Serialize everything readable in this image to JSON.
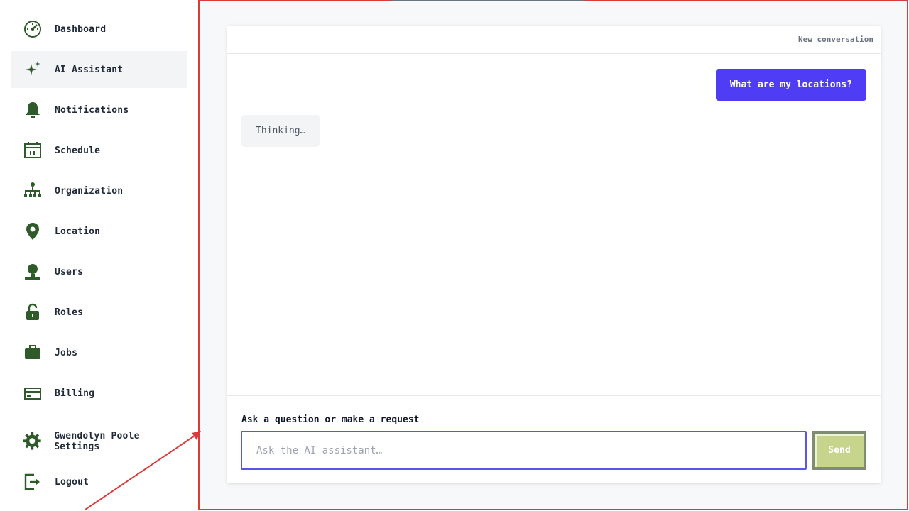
{
  "sidebar": {
    "items": [
      {
        "label": "Dashboard",
        "icon": "gauge-icon",
        "active": false
      },
      {
        "label": "AI Assistant",
        "icon": "sparkle-icon",
        "active": true
      },
      {
        "label": "Notifications",
        "icon": "bell-icon",
        "active": false
      },
      {
        "label": "Schedule",
        "icon": "calendar-icon",
        "active": false
      },
      {
        "label": "Organization",
        "icon": "org-chart-icon",
        "active": false
      },
      {
        "label": "Location",
        "icon": "map-pin-icon",
        "active": false
      },
      {
        "label": "Users",
        "icon": "user-icon",
        "active": false
      },
      {
        "label": "Roles",
        "icon": "lock-icon",
        "active": false
      },
      {
        "label": "Jobs",
        "icon": "briefcase-icon",
        "active": false
      },
      {
        "label": "Billing",
        "icon": "credit-card-icon",
        "active": false
      }
    ],
    "footer_items": [
      {
        "label": "Gwendolyn Poole Settings",
        "icon": "gear-icon"
      },
      {
        "label": "Logout",
        "icon": "logout-icon"
      }
    ]
  },
  "chat": {
    "new_conversation_label": "New conversation",
    "messages": [
      {
        "role": "user",
        "text": "What are my locations?"
      },
      {
        "role": "assistant",
        "text": "Thinking…"
      }
    ],
    "composer": {
      "label": "Ask a question or make a request",
      "placeholder": "Ask the AI assistant…",
      "value": "",
      "send_label": "Send"
    }
  },
  "colors": {
    "accent": "#4f3cf5",
    "icon": "#2f5a2a",
    "send_button": "#c6d48c",
    "annotation": "#d93a3a"
  }
}
